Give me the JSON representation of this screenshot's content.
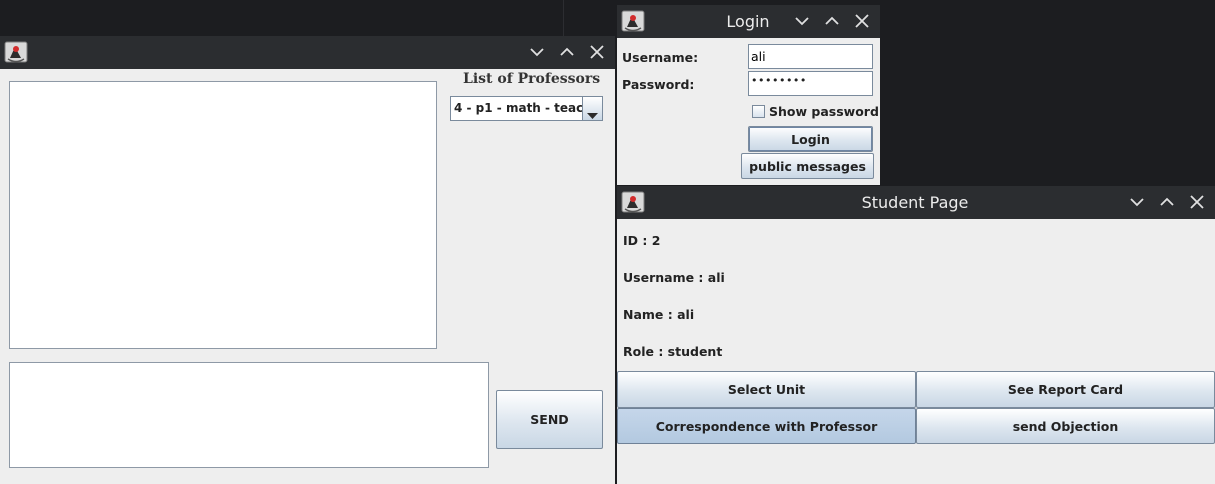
{
  "chat_window": {
    "title": "",
    "professors_label": "List of Professors",
    "professor_selected": "4 - p1 - math - teach...",
    "message_area_value": "",
    "input_value": "",
    "send_label": "SEND"
  },
  "login_window": {
    "title": "Login",
    "username_label": "Username:",
    "username_value": "ali",
    "password_label": "Password:",
    "password_value": "••••••••",
    "show_password_label": "Show password",
    "login_button": "Login",
    "public_messages_button": "public messages"
  },
  "student_window": {
    "title": "Student Page",
    "id_text": "ID : 2",
    "username_text": "Username : ali",
    "name_text": "Name : ali",
    "role_text": "Role : student",
    "buttons": {
      "select_unit": "Select Unit",
      "report_card": "See Report Card",
      "correspondence": "Correspondence with Professor",
      "objection": "send Objection"
    }
  },
  "icons": {
    "app": "java-duke-icon",
    "minimize": "chevron-down-icon",
    "maximize": "chevron-up-icon",
    "close": "close-icon",
    "dropdown": "caret-down-icon"
  },
  "colors": {
    "titlebar": "#2b2d30",
    "window_bg": "#eeeeee",
    "desktop": "#1c1d20",
    "button_gradient_end": "#c9d7e5",
    "pressed_button": "#b3c9e0",
    "field_border": "#8e99a6"
  }
}
